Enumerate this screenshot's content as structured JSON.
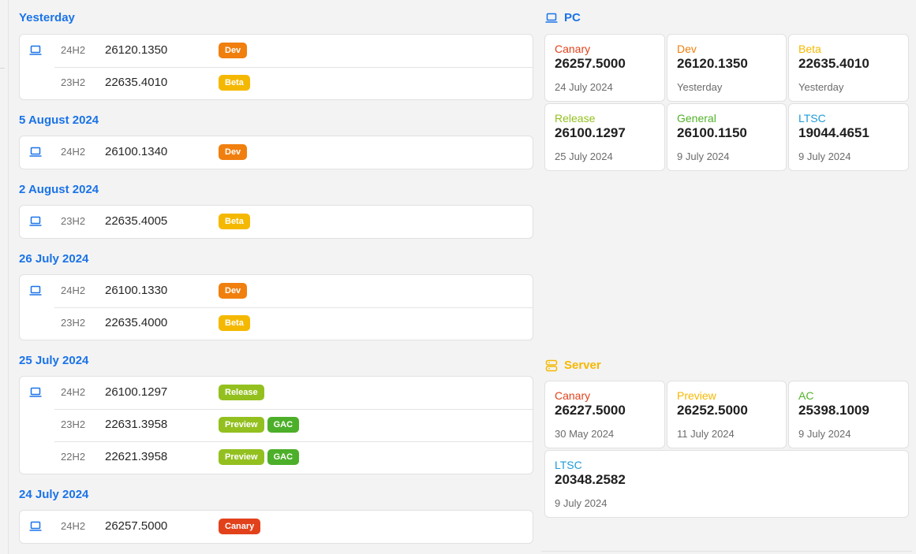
{
  "colors": {
    "accent": "#1a73e8",
    "canary": "#e2421b",
    "dev": "#f07f0e",
    "beta": "#f5b800",
    "release": "#93c01f",
    "preview": "#93c01f",
    "gac": "#4caf29",
    "general": "#52b22a",
    "ltsc": "#1f9bd6",
    "ac": "#52b22a",
    "server": "#f5b800"
  },
  "timeline": [
    {
      "date": "Yesterday",
      "rows": [
        {
          "icon": "laptop-icon",
          "version": "24H2",
          "build": "26120.1350",
          "badges": [
            {
              "label": "Dev",
              "color": "#f07f0e"
            }
          ]
        },
        {
          "icon": "",
          "version": "23H2",
          "build": "22635.4010",
          "badges": [
            {
              "label": "Beta",
              "color": "#f5b800"
            }
          ]
        }
      ]
    },
    {
      "date": "5 August 2024",
      "rows": [
        {
          "icon": "laptop-icon",
          "version": "24H2",
          "build": "26100.1340",
          "badges": [
            {
              "label": "Dev",
              "color": "#f07f0e"
            }
          ]
        }
      ]
    },
    {
      "date": "2 August 2024",
      "rows": [
        {
          "icon": "laptop-icon",
          "version": "23H2",
          "build": "22635.4005",
          "badges": [
            {
              "label": "Beta",
              "color": "#f5b800"
            }
          ]
        }
      ]
    },
    {
      "date": "26 July 2024",
      "rows": [
        {
          "icon": "laptop-icon",
          "version": "24H2",
          "build": "26100.1330",
          "badges": [
            {
              "label": "Dev",
              "color": "#f07f0e"
            }
          ]
        },
        {
          "icon": "",
          "version": "23H2",
          "build": "22635.4000",
          "badges": [
            {
              "label": "Beta",
              "color": "#f5b800"
            }
          ]
        }
      ]
    },
    {
      "date": "25 July 2024",
      "rows": [
        {
          "icon": "laptop-icon",
          "version": "24H2",
          "build": "26100.1297",
          "badges": [
            {
              "label": "Release",
              "color": "#93c01f"
            }
          ]
        },
        {
          "icon": "",
          "version": "23H2",
          "build": "22631.3958",
          "badges": [
            {
              "label": "Preview",
              "color": "#93c01f"
            },
            {
              "label": "GAC",
              "color": "#4caf29"
            }
          ]
        },
        {
          "icon": "",
          "version": "22H2",
          "build": "22621.3958",
          "badges": [
            {
              "label": "Preview",
              "color": "#93c01f"
            },
            {
              "label": "GAC",
              "color": "#4caf29"
            }
          ]
        }
      ]
    },
    {
      "date": "24 July 2024",
      "rows": [
        {
          "icon": "laptop-icon",
          "version": "24H2",
          "build": "26257.5000",
          "badges": [
            {
              "label": "Canary",
              "color": "#e2421b"
            }
          ]
        }
      ]
    }
  ],
  "pc": {
    "title": "PC",
    "icon": "laptop-icon",
    "tiles": [
      {
        "channel": "Canary",
        "color": "#e2421b",
        "build": "26257.5000",
        "date": "24 July 2024"
      },
      {
        "channel": "Dev",
        "color": "#f07f0e",
        "build": "26120.1350",
        "date": "Yesterday"
      },
      {
        "channel": "Beta",
        "color": "#f5b800",
        "build": "22635.4010",
        "date": "Yesterday"
      },
      {
        "channel": "Release",
        "color": "#93c01f",
        "build": "26100.1297",
        "date": "25 July 2024"
      },
      {
        "channel": "General",
        "color": "#52b22a",
        "build": "26100.1150",
        "date": "9 July 2024"
      },
      {
        "channel": "LTSC",
        "color": "#1f9bd6",
        "build": "19044.4651",
        "date": "9 July 2024"
      }
    ]
  },
  "server": {
    "title": "Server",
    "icon": "server-icon",
    "tiles": [
      {
        "channel": "Canary",
        "color": "#e2421b",
        "build": "26227.5000",
        "date": "30 May 2024"
      },
      {
        "channel": "Preview",
        "color": "#f5b800",
        "build": "26252.5000",
        "date": "11 July 2024"
      },
      {
        "channel": "AC",
        "color": "#52b22a",
        "build": "25398.1009",
        "date": "9 July 2024"
      },
      {
        "channel": "LTSC",
        "color": "#1f9bd6",
        "build": "20348.2582",
        "date": "9 July 2024"
      }
    ]
  }
}
